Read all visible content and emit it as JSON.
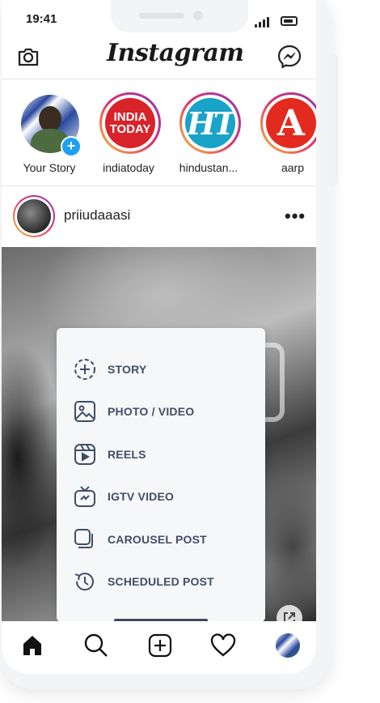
{
  "status_bar": {
    "time": "19:41"
  },
  "header": {
    "logo": "Instagram",
    "camera_icon": "camera-icon",
    "messenger_icon": "messenger-icon"
  },
  "stories": [
    {
      "name": "Your Story",
      "logo_text": ""
    },
    {
      "name": "indiatoday",
      "logo_text": "INDIA TODAY"
    },
    {
      "name": "hindustan...",
      "logo_text": "HT"
    },
    {
      "name": "aarp",
      "logo_text": "A"
    }
  ],
  "post": {
    "username": "priiudaaasi",
    "more": "•••"
  },
  "create_menu": {
    "items": [
      {
        "label": "STORY",
        "icon": "story-add-icon"
      },
      {
        "label": "PHOTO / VIDEO",
        "icon": "photo-icon"
      },
      {
        "label": "REELS",
        "icon": "reels-icon"
      },
      {
        "label": "IGTV VIDEO",
        "icon": "igtv-icon"
      },
      {
        "label": "CAROUSEL POST",
        "icon": "carousel-icon"
      },
      {
        "label": "SCHEDULED POST",
        "icon": "schedule-icon"
      }
    ]
  },
  "bottom_nav": [
    "home-icon",
    "search-icon",
    "create-icon",
    "heart-icon",
    "profile-avatar"
  ],
  "colors": {
    "menu_text": "#3f4e66",
    "story_ring_start": "#f9c13a",
    "story_ring_end": "#8a3ab9",
    "accent_blue": "#1da1f2"
  }
}
